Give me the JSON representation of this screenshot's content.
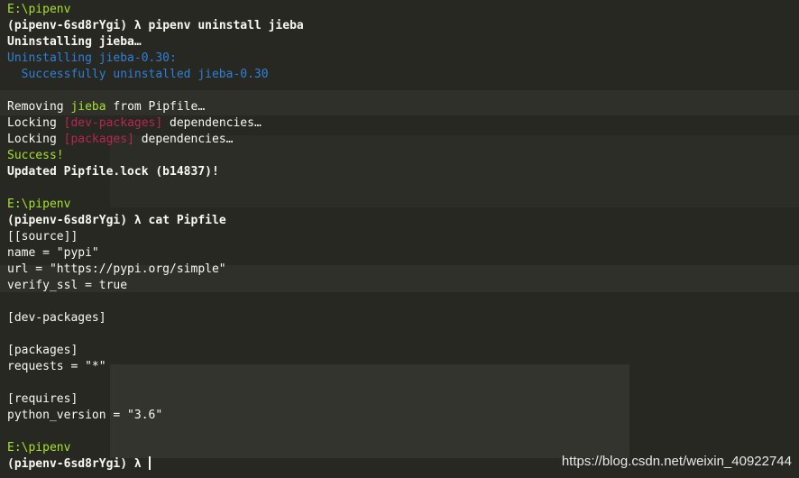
{
  "colors": {
    "background": "#272822",
    "prompt_path": "#a6e22e",
    "text": "#f8f8f2",
    "info_blue": "#2f7fd8",
    "success_green": "#a6e22e",
    "section_red": "#b8264e"
  },
  "session": {
    "block1": {
      "path": "E:\\pipenv",
      "prompt": "(pipenv-6sd8rYgi) λ ",
      "command": "pipenv uninstall jieba",
      "uninstalling": "Uninstalling jieba…",
      "uninstalling_version": "Uninstalling jieba-0.30:",
      "success_uninstalled": "  Successfully uninstalled jieba-0.30",
      "removing_prefix": "Removing ",
      "removing_pkg": "jieba",
      "removing_suffix": " from Pipfile…",
      "locking1_prefix": "Locking ",
      "locking1_section": "[dev-packages]",
      "locking1_suffix": " dependencies…",
      "locking2_prefix": "Locking ",
      "locking2_section": "[packages]",
      "locking2_suffix": " dependencies…",
      "success": "Success!",
      "updated": "Updated Pipfile.lock (b14837)!"
    },
    "block2": {
      "path": "E:\\pipenv",
      "prompt": "(pipenv-6sd8rYgi) λ ",
      "command": "cat Pipfile",
      "pipfile_lines": [
        "[[source]]",
        "name = \"pypi\"",
        "url = \"https://pypi.org/simple\"",
        "verify_ssl = true",
        "",
        "[dev-packages]",
        "",
        "[packages]",
        "requests = \"*\"",
        "",
        "[requires]",
        "python_version = \"3.6\""
      ]
    },
    "block3": {
      "path": "E:\\pipenv",
      "prompt": "(pipenv-6sd8rYgi) λ "
    }
  },
  "watermark": "https://blog.csdn.net/weixin_40922744"
}
